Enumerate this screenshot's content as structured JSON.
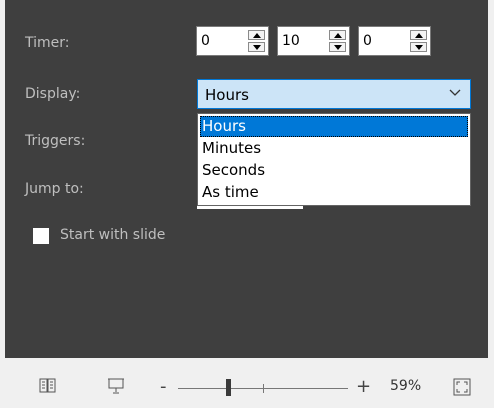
{
  "panel": {
    "timer": {
      "label": "Timer:",
      "hours": "0",
      "minutes": "10",
      "seconds": "0"
    },
    "display": {
      "label": "Display:",
      "selected": "Hours",
      "options": [
        "Hours",
        "Minutes",
        "Seconds",
        "As time"
      ]
    },
    "triggers": {
      "label": "Triggers:"
    },
    "jump_to": {
      "label": "Jump to:"
    },
    "start_with_slide": {
      "label": "Start with slide",
      "checked": false
    }
  },
  "statusbar": {
    "zoom_minus": "-",
    "zoom_plus": "+",
    "zoom_percent": "59%",
    "zoom_level": 59,
    "icons": [
      "reading-view-icon",
      "slide-show-icon",
      "fit-to-window-icon"
    ]
  },
  "colors": {
    "panel_bg": "#3f3f3f",
    "accent": "#0078d7",
    "select_bg": "#cce4f7"
  }
}
